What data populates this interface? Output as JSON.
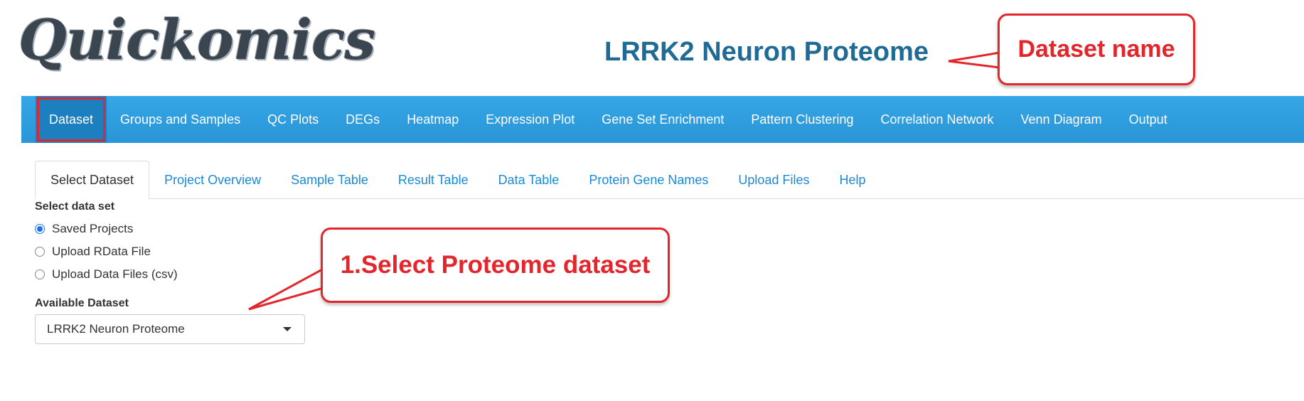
{
  "app": {
    "logo_text": "Quickomics",
    "dataset_title": "LRRK2 Neuron Proteome"
  },
  "navbar": {
    "items": [
      {
        "label": "Dataset",
        "active": true
      },
      {
        "label": "Groups and Samples"
      },
      {
        "label": "QC Plots"
      },
      {
        "label": "DEGs"
      },
      {
        "label": "Heatmap"
      },
      {
        "label": "Expression Plot"
      },
      {
        "label": "Gene Set Enrichment"
      },
      {
        "label": "Pattern Clustering"
      },
      {
        "label": "Correlation Network"
      },
      {
        "label": "Venn Diagram"
      },
      {
        "label": "Output"
      }
    ]
  },
  "tabs": [
    {
      "label": "Select Dataset",
      "active": true
    },
    {
      "label": "Project Overview"
    },
    {
      "label": "Sample Table"
    },
    {
      "label": "Result Table"
    },
    {
      "label": "Data Table"
    },
    {
      "label": "Protein Gene Names"
    },
    {
      "label": "Upload Files"
    },
    {
      "label": "Help"
    }
  ],
  "form": {
    "select_data_set_label": "Select data set",
    "radio_options": [
      {
        "label": "Saved Projects",
        "checked": true
      },
      {
        "label": "Upload RData File",
        "checked": false
      },
      {
        "label": "Upload Data Files (csv)",
        "checked": false
      }
    ],
    "available_dataset_label": "Available Dataset",
    "available_dataset_value": "LRRK2 Neuron Proteome"
  },
  "annotations": {
    "dataset_name_callout": "Dataset name",
    "select_proteome_callout": "1.Select Proteome dataset",
    "color": "#e3262b"
  },
  "colors": {
    "navbar": "#2a95d6",
    "title": "#1f6b95",
    "tab_link": "#1a8ad8"
  }
}
